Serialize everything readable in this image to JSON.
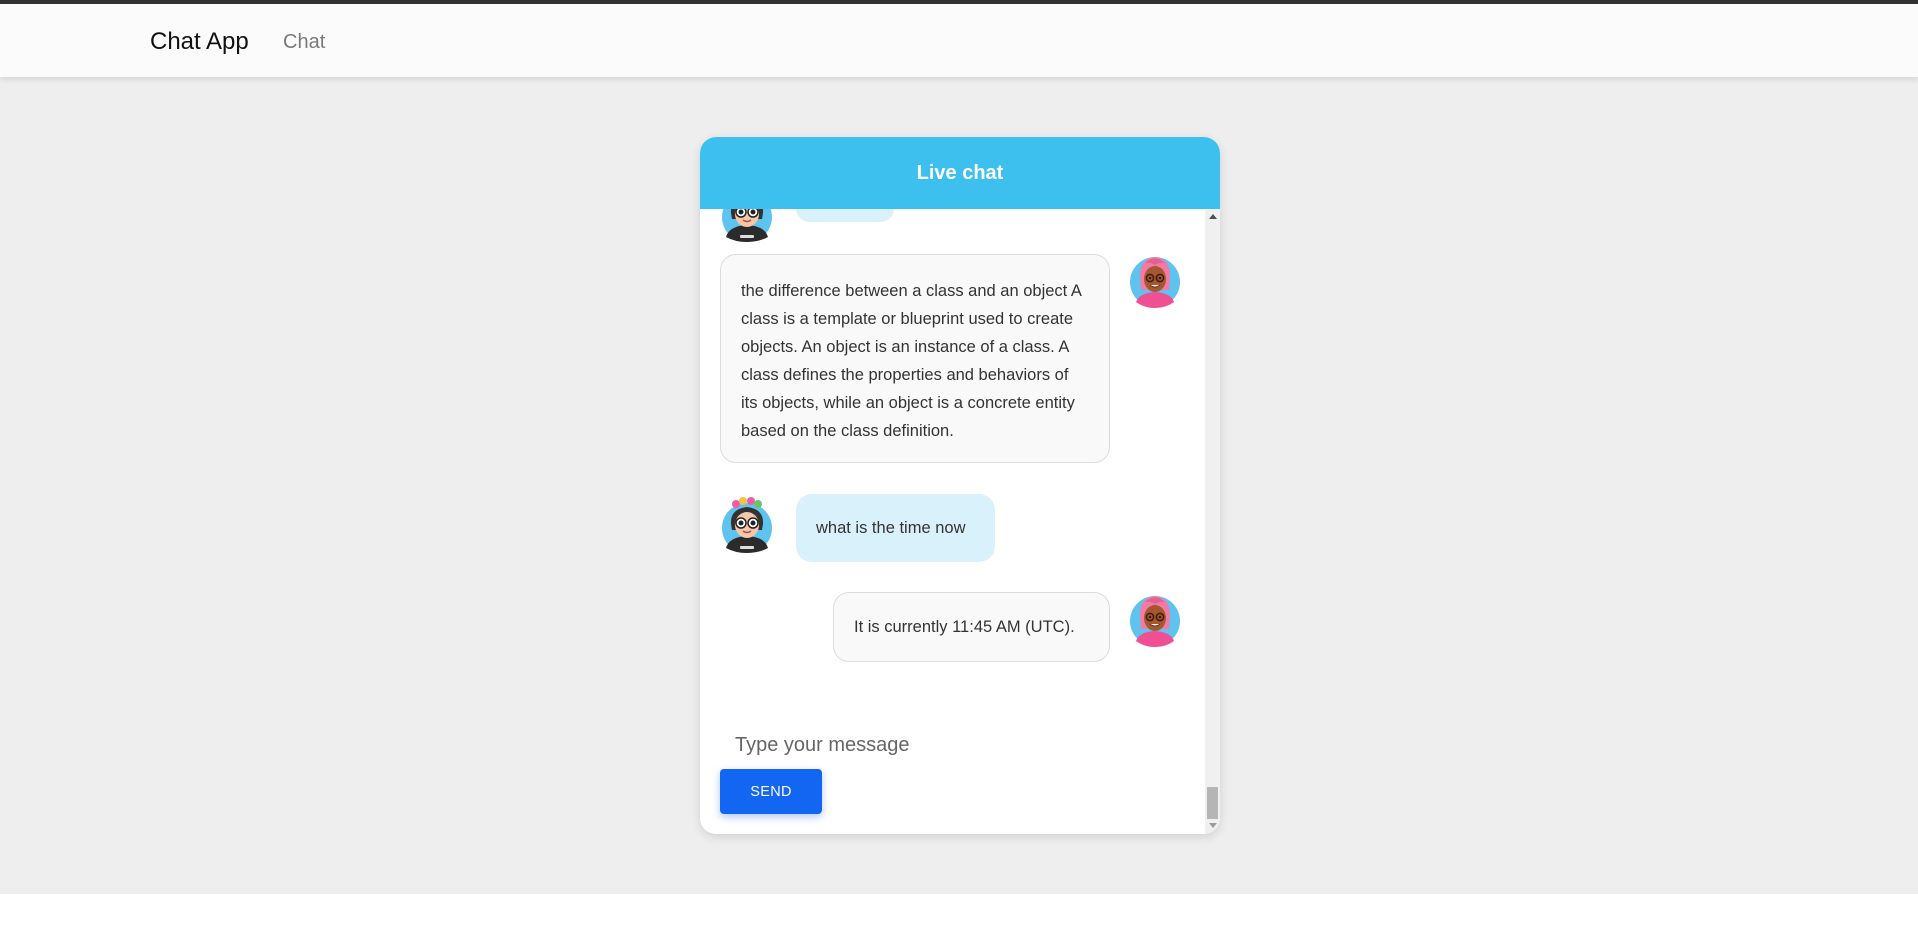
{
  "app": {
    "brand": "Chat App",
    "nav_links": [
      "Chat"
    ]
  },
  "chat": {
    "title": "Live chat",
    "messages": [
      {
        "sender": "user",
        "avatar": "woman-with-sunglasses-avatar",
        "text": ""
      },
      {
        "sender": "bot",
        "avatar": "woman-with-glasses-avatar",
        "text": "the difference between a class and an object A class is a template or blueprint used to create objects. An object is an instance of a class. A class defines the properties and behaviors of its objects, while an object is a concrete entity based on the class definition."
      },
      {
        "sender": "user",
        "avatar": "woman-with-sunglasses-avatar",
        "text": "what is the time now"
      },
      {
        "sender": "bot",
        "avatar": "woman-with-glasses-avatar",
        "text": "It is currently 11:45 AM (UTC)."
      }
    ],
    "input": {
      "placeholder": "Type your message",
      "value": ""
    },
    "send_label": "SEND"
  },
  "colors": {
    "header": "#3dc0ed",
    "user_bubble": "#d9f1fb",
    "bot_bubble": "#f9f9f9",
    "send_button": "#1266f1",
    "page_bg": "#eeeeee"
  }
}
